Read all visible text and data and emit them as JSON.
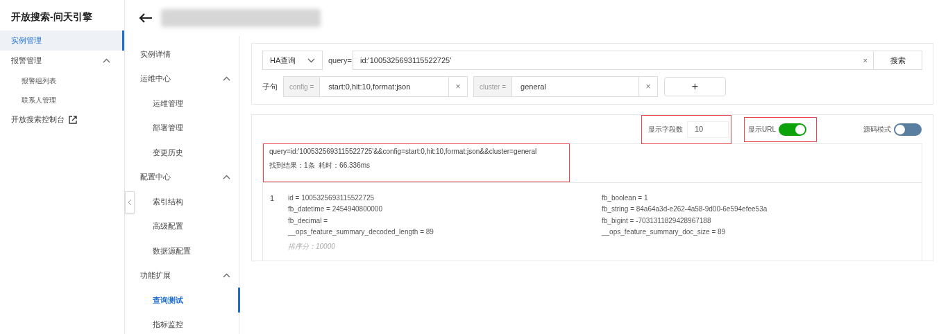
{
  "sidebar": {
    "title": "开放搜索-问天引擎",
    "items": [
      {
        "label": "实例管理",
        "selected": true,
        "kind": "item"
      },
      {
        "label": "报警管理",
        "selected": false,
        "kind": "group",
        "expanded": true,
        "children": [
          {
            "label": "报警组列表",
            "selected": false
          },
          {
            "label": "联系人管理",
            "selected": false
          }
        ]
      },
      {
        "label": "开放搜索控制台",
        "selected": false,
        "kind": "external"
      }
    ]
  },
  "subnav": {
    "items": [
      {
        "label": "实例详情",
        "selected": false,
        "kind": "item"
      },
      {
        "label": "运维中心",
        "kind": "group",
        "expanded": true,
        "selected": false,
        "children": [
          {
            "label": "运维管理",
            "selected": false
          },
          {
            "label": "部署管理",
            "selected": false
          },
          {
            "label": "变更历史",
            "selected": false
          }
        ]
      },
      {
        "label": "配置中心",
        "kind": "group",
        "expanded": true,
        "selected": false,
        "children": [
          {
            "label": "索引结构",
            "selected": false
          },
          {
            "label": "高级配置",
            "selected": false
          },
          {
            "label": "数据源配置",
            "selected": false
          }
        ]
      },
      {
        "label": "功能扩展",
        "kind": "group",
        "expanded": true,
        "selected": false,
        "children": [
          {
            "label": "查询测试",
            "selected": true
          },
          {
            "label": "指标监控",
            "selected": false
          }
        ]
      }
    ]
  },
  "search": {
    "mode": "HA查询",
    "query_label": "query=",
    "query_value": "id:'1005325693115522725'",
    "clear": "×",
    "button": "搜索",
    "clause_label": "子句",
    "clauses": [
      {
        "key": "config =",
        "value": "start:0,hit:10,format:json",
        "clear": "×"
      },
      {
        "key": "cluster =",
        "value": "general",
        "clear": "×"
      }
    ],
    "add_button": "+"
  },
  "results": {
    "field_count_label": "显示字段数",
    "field_count": "10",
    "show_url": {
      "label": "显示URL",
      "on": true
    },
    "source_mode": {
      "label": "源码模式",
      "on": false
    },
    "url": "query=id:'1005325693115522725'&&config=start:0,hit:10,format:json&&cluster=general",
    "summary": "找到结果：1条  耗时：66.336ms",
    "records": [
      {
        "index": "1",
        "fields_left": [
          "id = 1005325693115522725",
          "fb_datetime = 2454940800000",
          "fb_decimal =",
          "__ops_feature_summary_decoded_length = 89"
        ],
        "fields_right": [
          "fb_boolean = 1",
          "fb_string = 84a64a3d-e262-4a58-9d00-6e594efee53a",
          "fb_bigint = -7031311829428967188",
          "__ops_feature_summary_doc_size = 89"
        ],
        "score": "排序分：10000"
      }
    ]
  }
}
